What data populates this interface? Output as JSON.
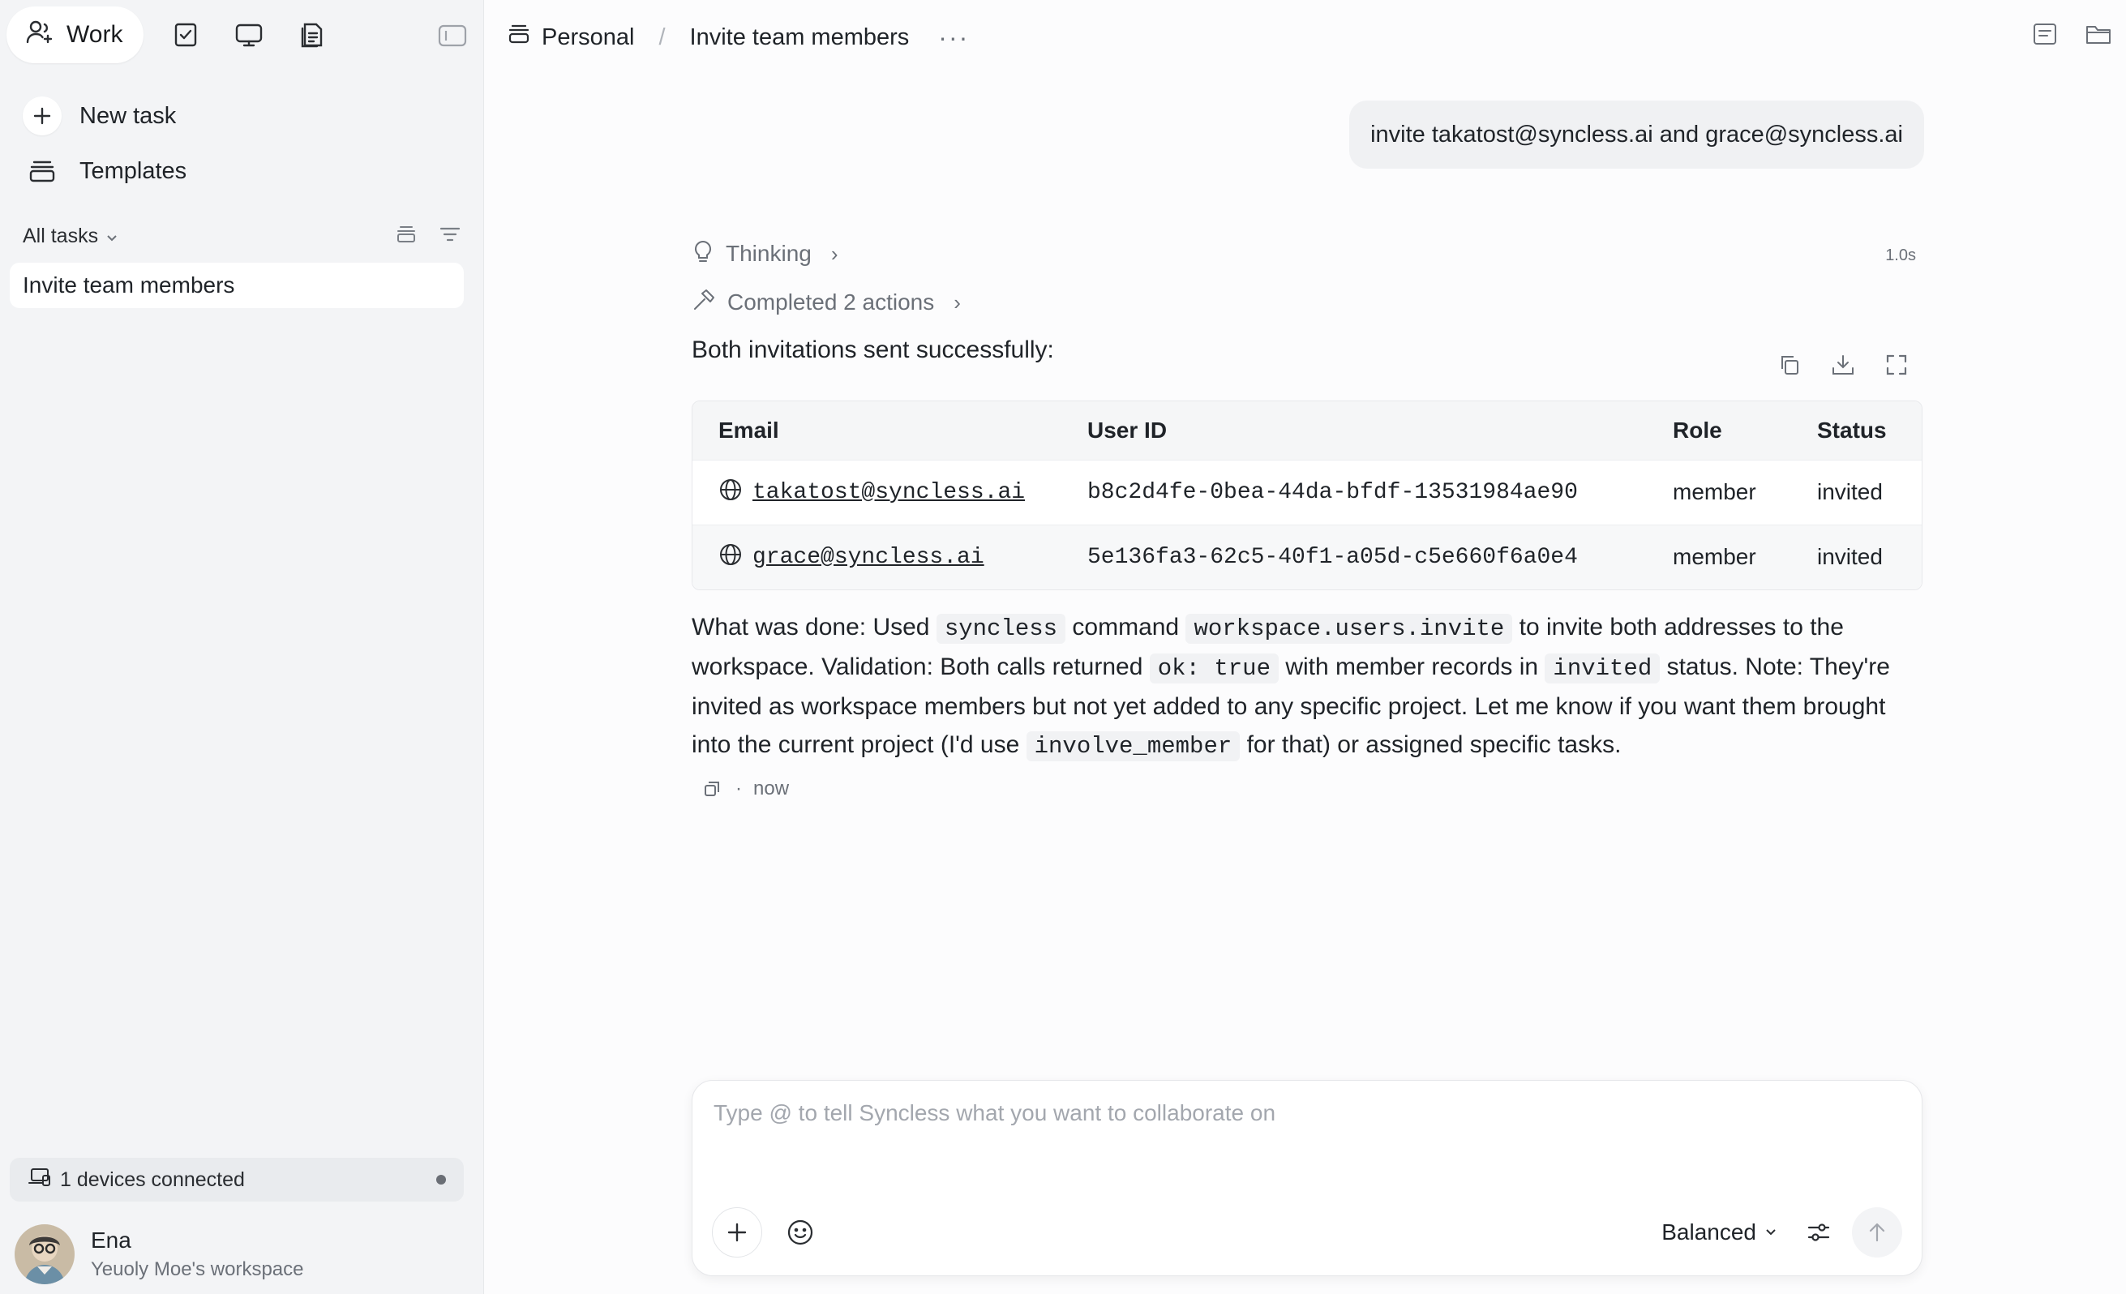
{
  "sidebar": {
    "workspace_tab": "Work",
    "new_task": "New task",
    "templates": "Templates",
    "filter_label": "All tasks",
    "tasks": [
      {
        "label": "Invite team members"
      }
    ],
    "devices": "1 devices connected",
    "user": {
      "name": "Ena",
      "workspace": "Yeuoly Moe's workspace"
    }
  },
  "header": {
    "crumb_project": "Personal",
    "crumb_separator": "/",
    "crumb_task": "Invite team members",
    "more": "···"
  },
  "chat": {
    "user_message": "invite takatost@syncless.ai and grace@syncless.ai",
    "thinking": "Thinking",
    "thinking_time": "1.0s",
    "actions": "Completed 2 actions",
    "intro": "Both invitations sent successfully:",
    "table": {
      "headers": [
        "Email",
        "User ID",
        "Role",
        "Status"
      ],
      "rows": [
        {
          "email": "takatost@syncless.ai",
          "user_id": "b8c2d4fe-0bea-44da-bfdf-13531984ae90",
          "role": "member",
          "status": "invited"
        },
        {
          "email": "grace@syncless.ai",
          "user_id": "5e136fa3-62c5-40f1-a05d-c5e660f6a0e4",
          "role": "member",
          "status": "invited"
        }
      ]
    },
    "body": {
      "t1": "What was done: Used ",
      "c1": "syncless",
      "t2": " command ",
      "c2": "workspace.users.invite",
      "t3": " to invite both addresses to the workspace. Validation: Both calls returned ",
      "c3": "ok: true",
      "t4": " with member records in ",
      "c4": "invited",
      "t5": " status. Note: They're invited as workspace members but not yet added to any specific project. Let me know if you want them brought into the current project (I'd use ",
      "c5": "involve_member",
      "t6": " for that) or assigned specific tasks."
    },
    "footer_sep": "·",
    "footer_time": "now"
  },
  "composer": {
    "placeholder": "Type @ to tell Syncless what you want to collaborate on",
    "mode": "Balanced"
  }
}
